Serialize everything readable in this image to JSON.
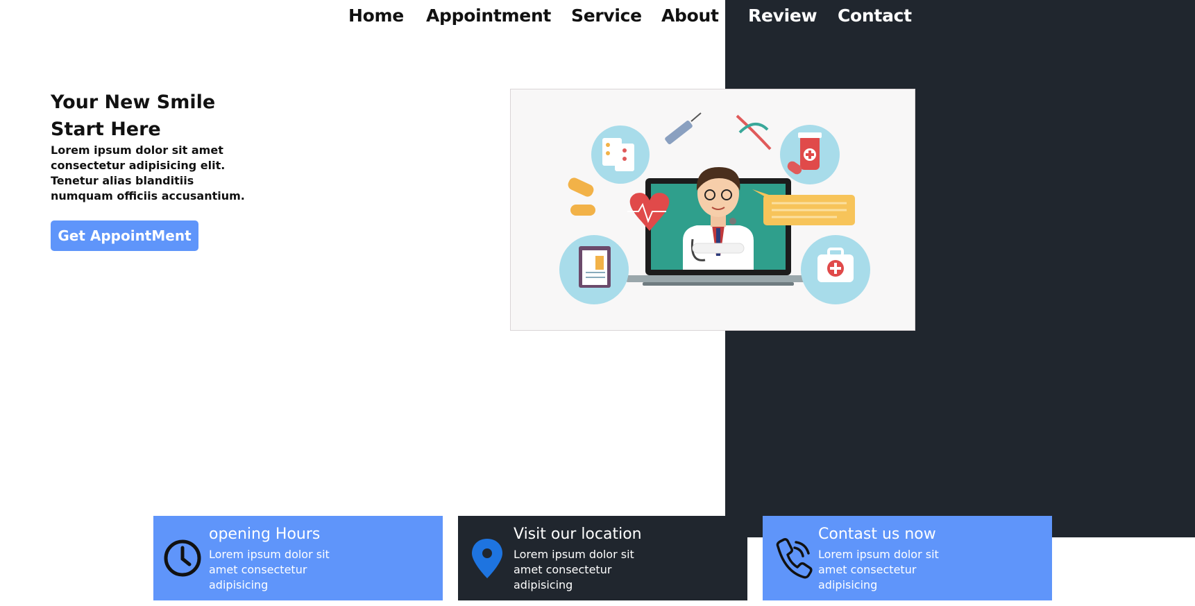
{
  "nav": {
    "home": "Home",
    "appointment": "Appointment",
    "service": "Service",
    "about": "About",
    "review": "Review",
    "contact": "Contact"
  },
  "hero": {
    "title_line1": "Your New Smile",
    "title_line2": "Start Here",
    "description": "Lorem ipsum dolor sit amet consectetur adipisicing elit. Tenetur alias blanditiis numquam officiis accusantium.",
    "cta_label": "Get AppointMent",
    "illustration": "doctor-telemedicine-illustration"
  },
  "cards": [
    {
      "icon": "clock-icon",
      "title": "opening Hours",
      "text": "Lorem ipsum dolor sit amet consectetur adipisicing"
    },
    {
      "icon": "location-pin-icon",
      "title": "Visit our location",
      "text": "Lorem ipsum dolor sit amet consectetur adipisicing"
    },
    {
      "icon": "phone-icon",
      "title": "Contast us now",
      "text": "Lorem ipsum dolor sit amet consectetur adipisicing"
    }
  ],
  "colors": {
    "accent": "#5f95fa",
    "dark": "#20262e",
    "pin": "#1e74e0"
  }
}
